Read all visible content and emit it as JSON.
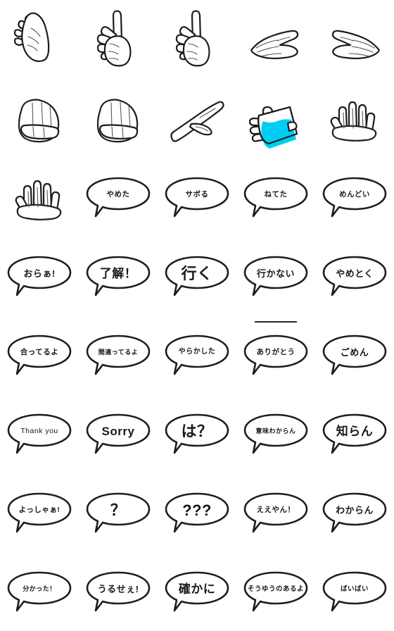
{
  "sheet": {
    "title": "Hand Gestures and Speech Bubbles Sticker Set",
    "columns": 5,
    "rows": 8,
    "background_color": "#ffffff",
    "ink_color": "#1a1a1a",
    "accent_color": "#00cdf2"
  },
  "items": [
    {
      "id": 1,
      "kind": "hand",
      "icon": "finger-snap-hand-icon",
      "label": ""
    },
    {
      "id": 2,
      "kind": "hand",
      "icon": "index-finger-up-hand-icon",
      "label": ""
    },
    {
      "id": 3,
      "kind": "hand",
      "icon": "index-finger-up-hand-icon-2",
      "label": ""
    },
    {
      "id": 4,
      "kind": "hand",
      "icon": "flat-hand-left-icon",
      "label": ""
    },
    {
      "id": 5,
      "kind": "hand",
      "icon": "flat-hand-right-icon",
      "label": ""
    },
    {
      "id": 6,
      "kind": "hand",
      "icon": "fist-hand-icon",
      "label": ""
    },
    {
      "id": 7,
      "kind": "hand",
      "icon": "fist-hand-icon-2",
      "label": ""
    },
    {
      "id": 8,
      "kind": "hand",
      "icon": "pointing-hand-icon",
      "label": ""
    },
    {
      "id": 9,
      "kind": "hand",
      "icon": "hand-holding-cup-icon",
      "label": ""
    },
    {
      "id": 10,
      "kind": "hand",
      "icon": "spread-fingers-hand-icon",
      "label": ""
    },
    {
      "id": 11,
      "kind": "hand",
      "icon": "spread-fingers-hand-icon-2",
      "label": ""
    },
    {
      "id": 12,
      "kind": "bubble",
      "icon": "speech-bubble-icon",
      "label": "やめた",
      "size": "sm"
    },
    {
      "id": 13,
      "kind": "bubble",
      "icon": "speech-bubble-icon",
      "label": "サボる",
      "size": "sm"
    },
    {
      "id": 14,
      "kind": "bubble",
      "icon": "speech-bubble-icon",
      "label": "ねてた",
      "size": "sm"
    },
    {
      "id": 15,
      "kind": "bubble",
      "icon": "speech-bubble-icon",
      "label": "めんどい",
      "size": "sm"
    },
    {
      "id": 16,
      "kind": "bubble",
      "icon": "speech-bubble-icon",
      "label": "おらぁ!",
      "size": "md"
    },
    {
      "id": 17,
      "kind": "bubble",
      "icon": "speech-bubble-icon",
      "label": "了解！",
      "size": "lg"
    },
    {
      "id": 18,
      "kind": "bubble",
      "icon": "speech-bubble-icon",
      "label": "行く",
      "size": "xl"
    },
    {
      "id": 19,
      "kind": "bubble",
      "icon": "speech-bubble-icon",
      "label": "行かない",
      "size": "md"
    },
    {
      "id": 20,
      "kind": "bubble",
      "icon": "speech-bubble-icon",
      "label": "やめとく",
      "size": "md"
    },
    {
      "id": 21,
      "kind": "bubble",
      "icon": "speech-bubble-icon",
      "label": "合ってるよ",
      "size": "sm"
    },
    {
      "id": 22,
      "kind": "bubble",
      "icon": "speech-bubble-icon",
      "label": "間違ってるよ",
      "size": "xs"
    },
    {
      "id": 23,
      "kind": "bubble",
      "icon": "speech-bubble-icon",
      "label": "やらかした",
      "size": "blur"
    },
    {
      "id": 24,
      "kind": "bubble",
      "icon": "speech-bubble-icon",
      "label": "ありがとう",
      "size": "sm",
      "separator": true
    },
    {
      "id": 25,
      "kind": "bubble",
      "icon": "speech-bubble-icon",
      "label": "ごめん",
      "size": "md"
    },
    {
      "id": 26,
      "kind": "bubble",
      "icon": "speech-bubble-icon",
      "label": "Thank you",
      "size": "thin"
    },
    {
      "id": 27,
      "kind": "bubble",
      "icon": "speech-bubble-icon",
      "label": "Sorry",
      "size": "lg"
    },
    {
      "id": 28,
      "kind": "bubble",
      "icon": "speech-bubble-icon",
      "label": "は？",
      "size": "xl"
    },
    {
      "id": 29,
      "kind": "bubble",
      "icon": "speech-bubble-icon",
      "label": "意味わからん",
      "size": "xs"
    },
    {
      "id": 30,
      "kind": "bubble",
      "icon": "speech-bubble-icon",
      "label": "知らん",
      "size": "lg"
    },
    {
      "id": 31,
      "kind": "bubble",
      "icon": "speech-bubble-icon",
      "label": "よっしゃぁ!",
      "size": "sm"
    },
    {
      "id": 32,
      "kind": "bubble",
      "icon": "speech-bubble-icon",
      "label": "？",
      "size": "xl"
    },
    {
      "id": 33,
      "kind": "bubble",
      "icon": "speech-bubble-icon",
      "label": "???",
      "size": "xl"
    },
    {
      "id": 34,
      "kind": "bubble",
      "icon": "speech-bubble-icon",
      "label": "ええやん！",
      "size": "sm"
    },
    {
      "id": 35,
      "kind": "bubble",
      "icon": "speech-bubble-icon",
      "label": "わからん",
      "size": "md"
    },
    {
      "id": 36,
      "kind": "bubble",
      "icon": "speech-bubble-icon",
      "label": "分かった！",
      "size": "xs"
    },
    {
      "id": 37,
      "kind": "bubble",
      "icon": "speech-bubble-icon",
      "label": "うるせぇ!",
      "size": "md"
    },
    {
      "id": 38,
      "kind": "bubble",
      "icon": "speech-bubble-icon",
      "label": "確かに",
      "size": "lg"
    },
    {
      "id": 39,
      "kind": "bubble",
      "icon": "speech-bubble-icon",
      "label": "そうゆうのあるよ",
      "size": "blur2"
    },
    {
      "id": 40,
      "kind": "bubble",
      "icon": "speech-bubble-icon",
      "label": "ばいばい",
      "size": "blur2"
    }
  ]
}
